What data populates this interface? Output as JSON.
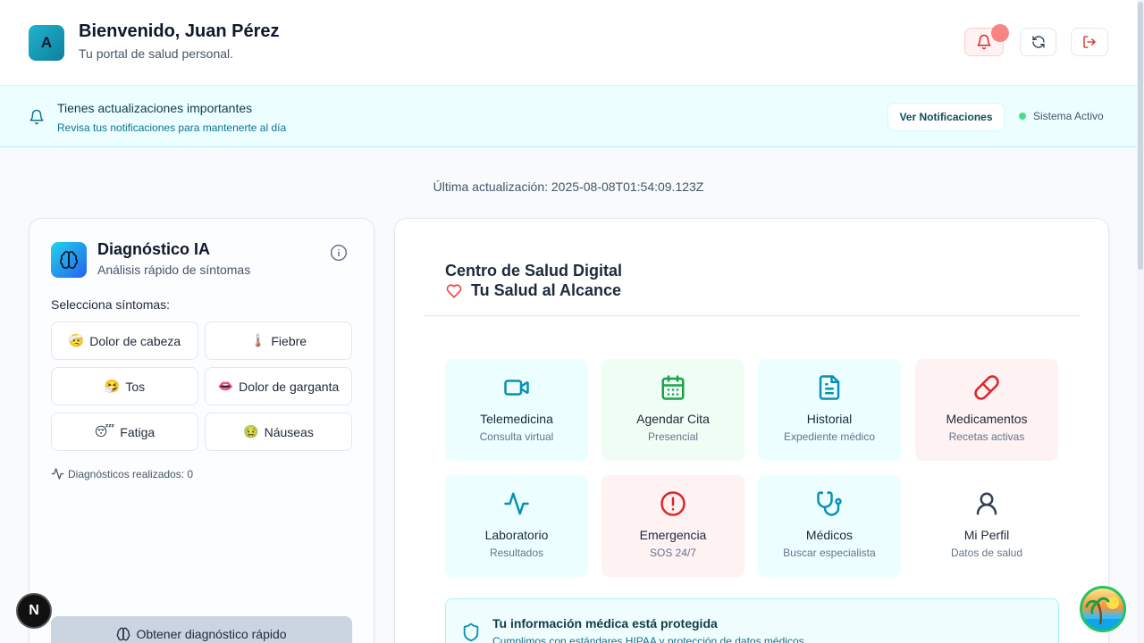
{
  "header": {
    "avatar_letter": "A",
    "welcome": "Bienvenido, Juan Pérez",
    "subtitle": "Tu portal de salud personal."
  },
  "banner": {
    "title": "Tienes actualizaciones importantes",
    "subtitle": "Revisa tus notificaciones para mantenerte al día",
    "button": "Ver Notificaciones",
    "status": "Sistema Activo"
  },
  "last_update": "Última actualización: 2025-08-08T01:54:09.123Z",
  "diagnosis": {
    "title": "Diagnóstico IA",
    "subtitle": "Análisis rápido de síntomas",
    "select_label": "Selecciona síntomas:",
    "symptoms": [
      {
        "emoji": "🤕",
        "label": "Dolor de cabeza"
      },
      {
        "emoji": "🌡️",
        "label": "Fiebre"
      },
      {
        "emoji": "🤧",
        "label": "Tos"
      },
      {
        "emoji": "👄",
        "label": "Dolor de garganta"
      },
      {
        "emoji": "😴",
        "label": "Fatiga"
      },
      {
        "emoji": "🤢",
        "label": "Náuseas"
      }
    ],
    "count_text": "Diagnósticos realizados: 0",
    "button": "Obtener diagnóstico rápido"
  },
  "health_center": {
    "title": "Centro de Salud Digital",
    "subtitle": "Tu Salud al Alcance",
    "tiles": [
      {
        "title": "Telemedicina",
        "sub": "Consulta virtual",
        "icon": "video-icon"
      },
      {
        "title": "Agendar Cita",
        "sub": "Presencial",
        "icon": "calendar-icon"
      },
      {
        "title": "Historial",
        "sub": "Expediente médico",
        "icon": "document-icon"
      },
      {
        "title": "Medicamentos",
        "sub": "Recetas activas",
        "icon": "pill-icon"
      },
      {
        "title": "Laboratorio",
        "sub": "Resultados",
        "icon": "activity-icon"
      },
      {
        "title": "Emergencia",
        "sub": "SOS 24/7",
        "icon": "alert-icon"
      },
      {
        "title": "Médicos",
        "sub": "Buscar especialista",
        "icon": "stethoscope-icon"
      },
      {
        "title": "Mi Perfil",
        "sub": "Datos de salud",
        "icon": "user-icon"
      }
    ],
    "protect_title": "Tu información médica está protegida",
    "protect_sub": "Cumplimos con estándares HIPAA y protección de datos médicos"
  },
  "floating": {
    "dev_badge": "N"
  },
  "colors": {
    "accent": "#0891b2",
    "green": "#16a34a",
    "red": "#dc2626",
    "status_green": "#4ade80"
  }
}
